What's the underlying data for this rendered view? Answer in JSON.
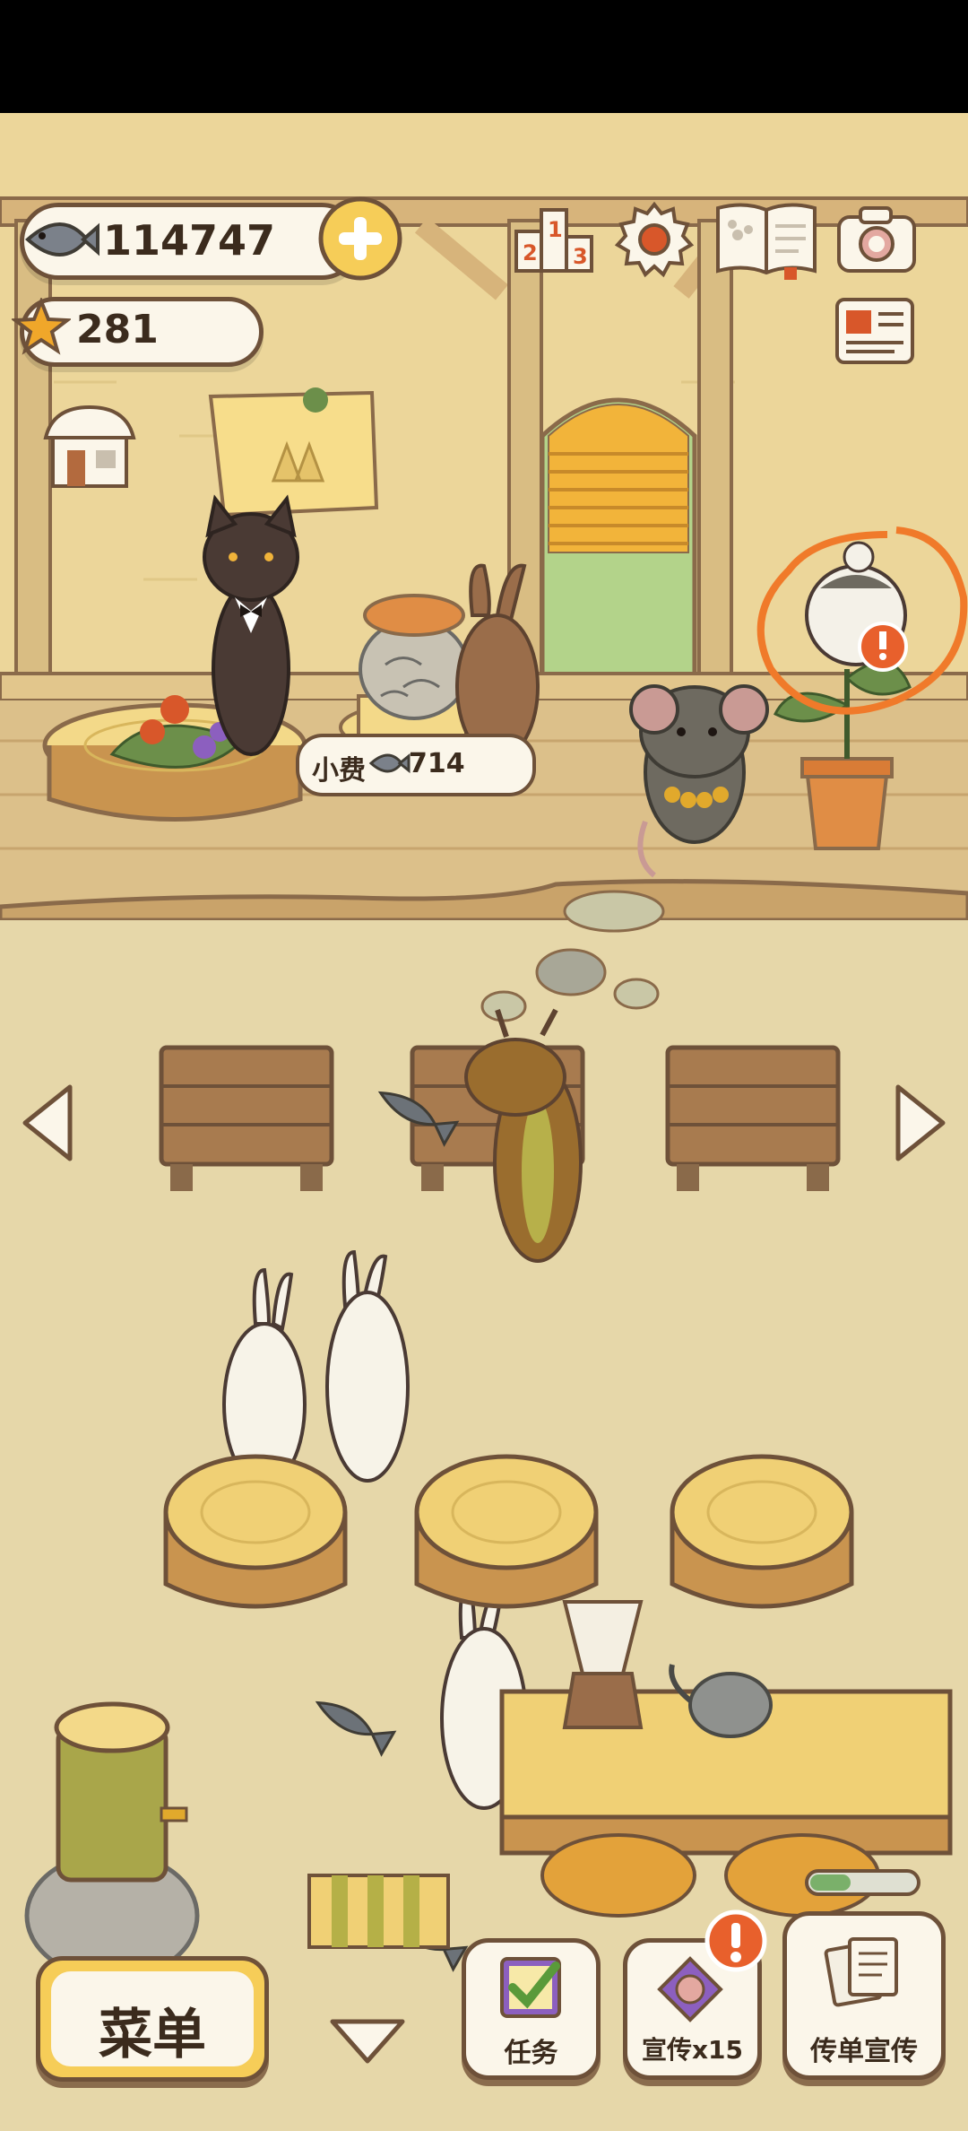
{
  "hud": {
    "fish_count": "114747",
    "star_count": "281"
  },
  "scene": {
    "tip_label": "小费",
    "tip_amount": "714"
  },
  "bottom_bar": {
    "menu_label": "菜单",
    "task_label": "任务",
    "promo_label": "宣传x15",
    "flyer_label": "传单宣传"
  },
  "colors": {
    "wall": "#ecd69a",
    "floor": "#e6d7a9",
    "wood": "#8a6a4a",
    "outline": "#6e5139",
    "accent_yellow": "#f6cd58",
    "alert_orange": "#e8602c",
    "highlight_circle": "#f07a2a"
  },
  "icons": [
    "fish-icon",
    "plus-icon",
    "star-icon",
    "ranking-icon",
    "gear-icon",
    "book-icon",
    "camera-icon",
    "newspaper-icon",
    "shop-icon",
    "arrow-left-icon",
    "arrow-right-icon",
    "chevron-down-icon",
    "clipboard-check-icon",
    "poster-icon",
    "flyer-icon"
  ]
}
